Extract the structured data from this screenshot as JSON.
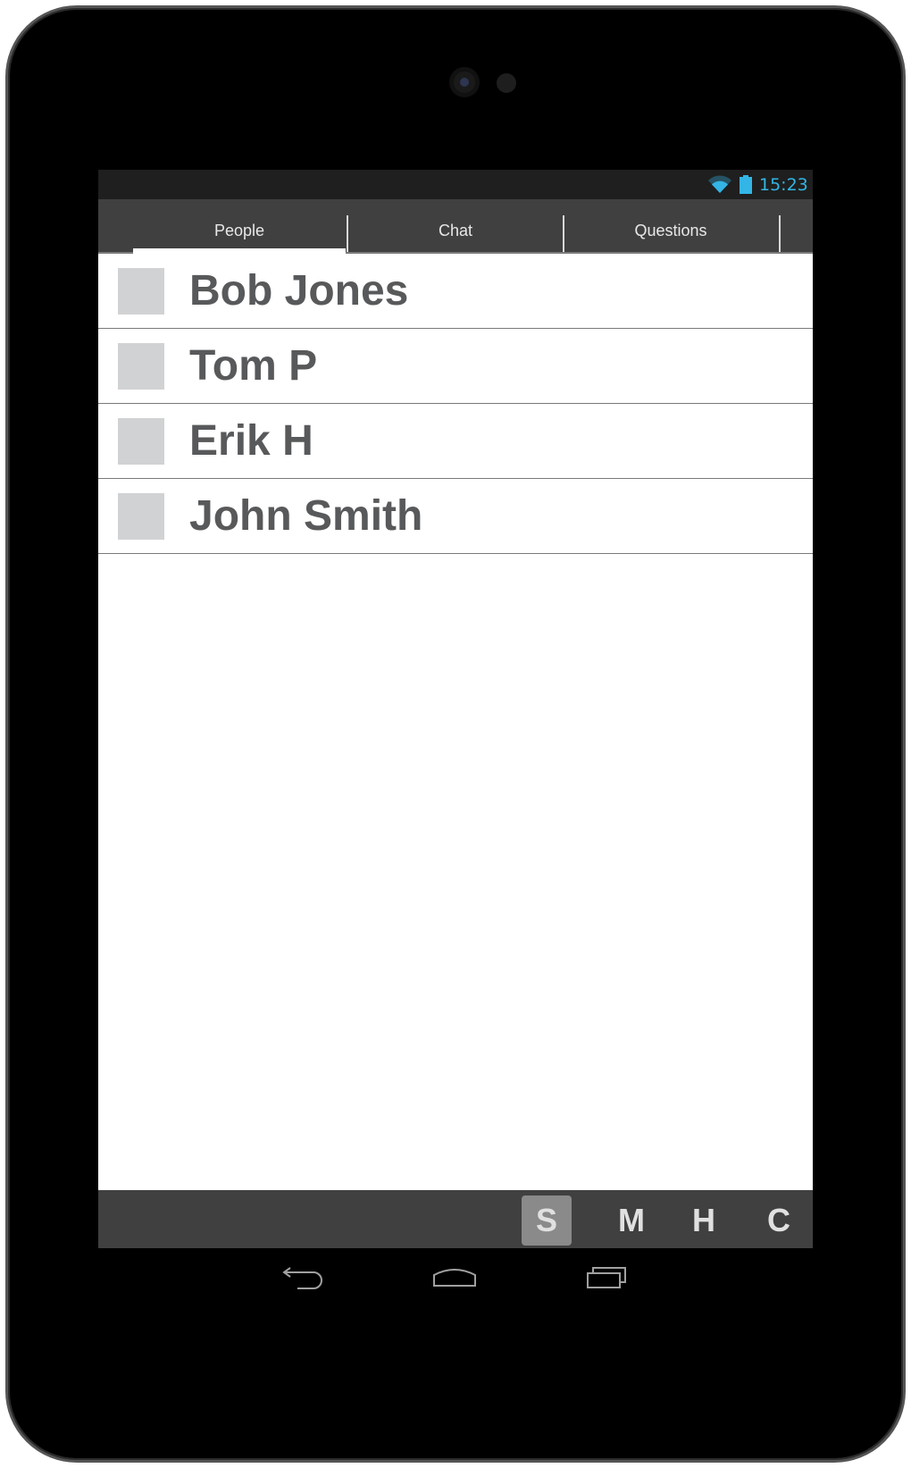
{
  "status_bar": {
    "time": "15:23",
    "accent_color": "#33b5e5",
    "icons": [
      "wifi-icon",
      "battery-icon"
    ]
  },
  "tabs": [
    {
      "label": "People",
      "selected": true
    },
    {
      "label": "Chat",
      "selected": false
    },
    {
      "label": "Questions",
      "selected": false
    }
  ],
  "people": [
    {
      "name": "Bob Jones"
    },
    {
      "name": "Tom P"
    },
    {
      "name": "Erik H"
    },
    {
      "name": "John Smith"
    }
  ],
  "bottom_bar": {
    "buttons": [
      {
        "label": "S",
        "selected": true
      },
      {
        "label": "M",
        "selected": false
      },
      {
        "label": "H",
        "selected": false
      },
      {
        "label": "C",
        "selected": false
      }
    ]
  },
  "nav": {
    "icons": [
      "back-icon",
      "home-icon",
      "recent-apps-icon"
    ]
  }
}
